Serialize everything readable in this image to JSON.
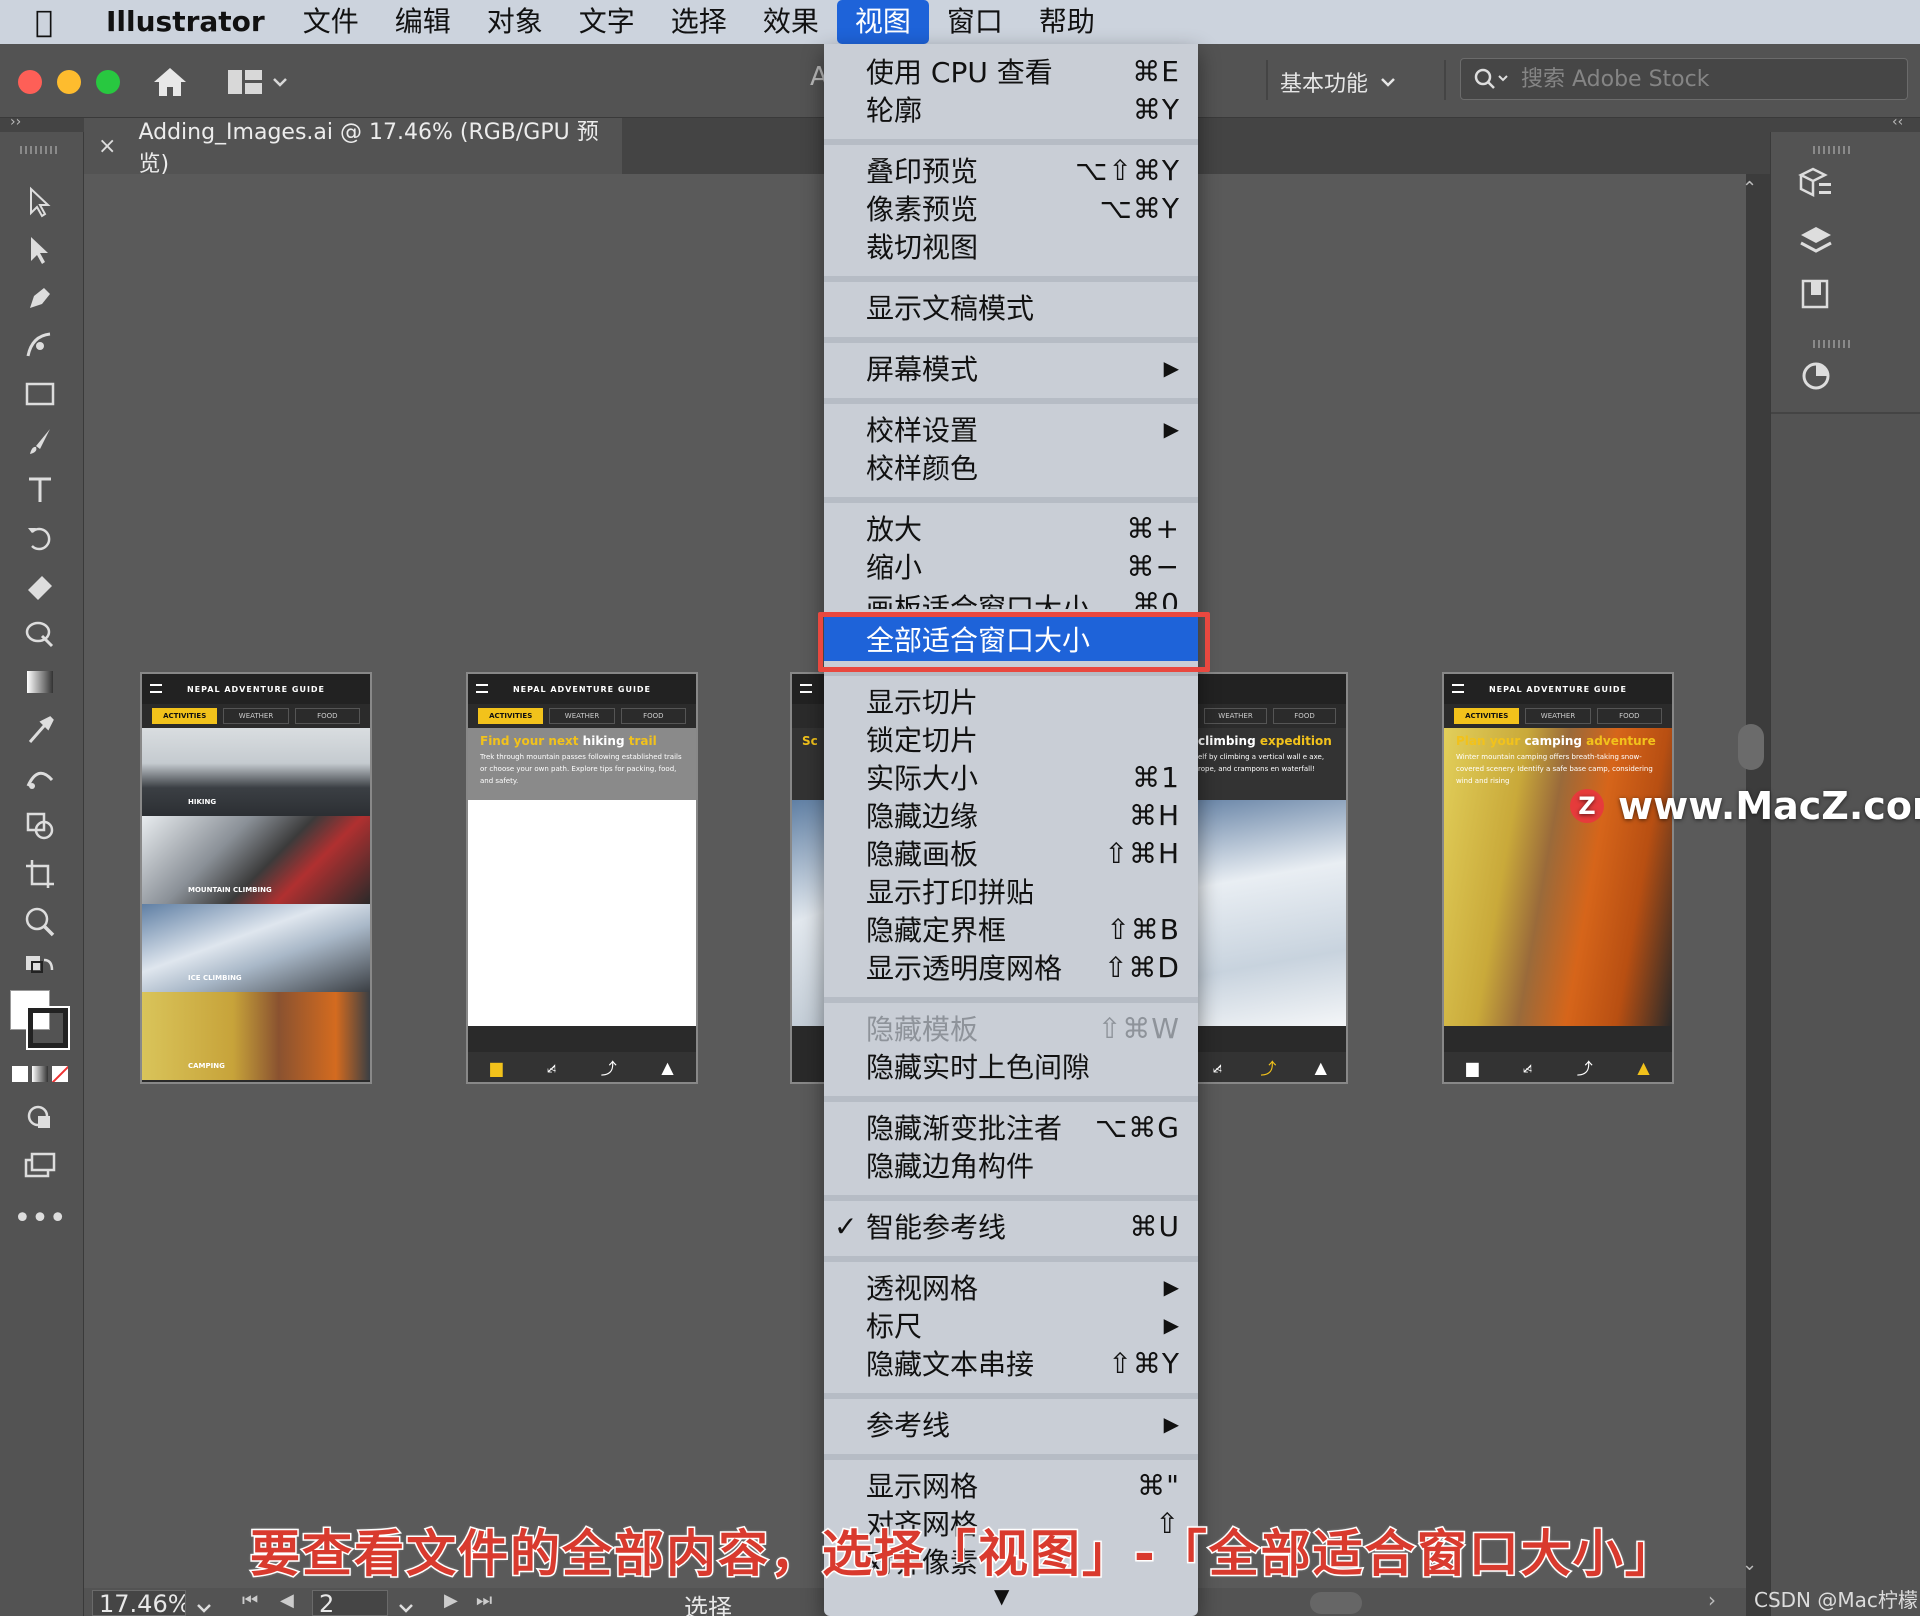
{
  "menubar": {
    "app_name": "Illustrator",
    "items": [
      "文件",
      "编辑",
      "对象",
      "文字",
      "选择",
      "效果",
      "视图",
      "窗口",
      "帮助"
    ],
    "active_item": "视图"
  },
  "topbar": {
    "workspace_label": "基本功能",
    "search_placeholder": "搜索 Adobe Stock",
    "partial_title_char": "A"
  },
  "document_tab": {
    "title": "Adding_Images.ai @ 17.46% (RGB/GPU 预览)"
  },
  "view_menu": {
    "items": [
      {
        "label": "使用 CPU 查看",
        "shortcut": "⌘E"
      },
      {
        "label": "轮廓",
        "shortcut": "⌘Y"
      },
      {
        "label": "叠印预览",
        "shortcut": "⌥⇧⌘Y"
      },
      {
        "label": "像素预览",
        "shortcut": "⌥⌘Y"
      },
      {
        "label": "裁切视图",
        "shortcut": ""
      },
      {
        "label": "显示文稿模式",
        "shortcut": ""
      },
      {
        "label": "屏幕模式",
        "shortcut": "▶"
      },
      {
        "label": "校样设置",
        "shortcut": "▶"
      },
      {
        "label": "校样颜色",
        "shortcut": ""
      },
      {
        "label": "放大",
        "shortcut": "⌘+"
      },
      {
        "label": "缩小",
        "shortcut": "⌘−"
      },
      {
        "label": "画板适合窗口大小",
        "shortcut": "⌘0"
      },
      {
        "label": "全部适合窗口大小",
        "shortcut": ""
      },
      {
        "label": "显示切片",
        "shortcut": ""
      },
      {
        "label": "锁定切片",
        "shortcut": ""
      },
      {
        "label": "实际大小",
        "shortcut": "⌘1"
      },
      {
        "label": "隐藏边缘",
        "shortcut": "⌘H"
      },
      {
        "label": "隐藏画板",
        "shortcut": "⇧⌘H"
      },
      {
        "label": "显示打印拼贴",
        "shortcut": ""
      },
      {
        "label": "隐藏定界框",
        "shortcut": "⇧⌘B"
      },
      {
        "label": "显示透明度网格",
        "shortcut": "⇧⌘D"
      },
      {
        "label": "隐藏模板",
        "shortcut": "⇧⌘W"
      },
      {
        "label": "隐藏实时上色间隙",
        "shortcut": ""
      },
      {
        "label": "隐藏渐变批注者",
        "shortcut": "⌥⌘G"
      },
      {
        "label": "隐藏边角构件",
        "shortcut": ""
      },
      {
        "label": "智能参考线",
        "shortcut": "⌘U",
        "checked": "✓"
      },
      {
        "label": "透视网格",
        "shortcut": "▶"
      },
      {
        "label": "标尺",
        "shortcut": "▶"
      },
      {
        "label": "隐藏文本串接",
        "shortcut": "⇧⌘Y"
      },
      {
        "label": "参考线",
        "shortcut": "▶"
      },
      {
        "label": "显示网格",
        "shortcut": "⌘\""
      },
      {
        "label": "对齐网格",
        "shortcut": "⇧"
      },
      {
        "label": "对齐像素",
        "shortcut": ""
      }
    ],
    "highlighted": "全部适合窗口大小",
    "disabled": "隐藏模板",
    "scroll_arrow": "▼"
  },
  "artboards": {
    "header": "NEPAL ADVENTURE GUIDE",
    "tabs": [
      "ACTIVITIES",
      "WEATHER",
      "FOOD"
    ],
    "ab1_tiles": [
      "HIKING",
      "MOUNTAIN CLIMBING",
      "ICE CLIMBING",
      "CAMPING"
    ],
    "ab2": {
      "heading_a": "Find your next ",
      "heading_b": "hiking",
      "heading_c": " trail",
      "body": "Trek through mountain passes following established trails or choose your own path. Explore tips for packing, food, and safety."
    },
    "ab3_partial": "Sc",
    "ab4": {
      "heading_a": "climbing ",
      "heading_b": "expedition",
      "body": "elf by climbing a vertical wall e axe, rope, and crampons en waterfall!"
    },
    "ab5": {
      "heading_a": "Plan your ",
      "heading_b": "camping",
      "heading_c": " adventure",
      "body": "Winter mountain camping offers breath-taking snow-covered scenery. Identify a safe base camp, considering wind and rising"
    }
  },
  "statusbar": {
    "zoom": "17.46%",
    "page": "2",
    "tool": "选择"
  },
  "caption": "要查看文件的全部内容，选择「视图」-「全部适合窗口大小」",
  "watermarks": {
    "macz": "www.MacZ.com",
    "csdn": "CSDN @Mac柠檬"
  },
  "colors": {
    "accent_blue": "#1e63d9",
    "highlight_box": "#e8483f",
    "brand_yellow": "#f2c21b"
  }
}
